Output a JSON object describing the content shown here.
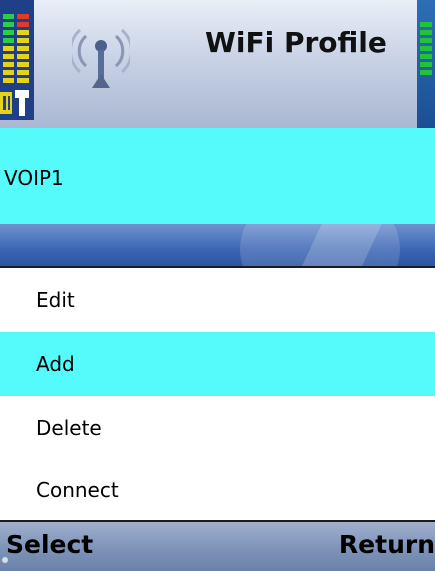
{
  "header": {
    "title": "WiFi Profile",
    "icon": "wifi-antenna-icon"
  },
  "profile": {
    "name": "VOIP1"
  },
  "menu": {
    "items": [
      {
        "label": "Edit",
        "selected": false
      },
      {
        "label": "Add",
        "selected": true
      },
      {
        "label": "Delete",
        "selected": false
      },
      {
        "label": "Connect",
        "selected": false
      }
    ]
  },
  "softkeys": {
    "left": "Select",
    "right": "Return"
  },
  "colors": {
    "highlight": "#55fbfb",
    "signal_green": "#22c33b",
    "header_blue": "#1f3f86"
  }
}
